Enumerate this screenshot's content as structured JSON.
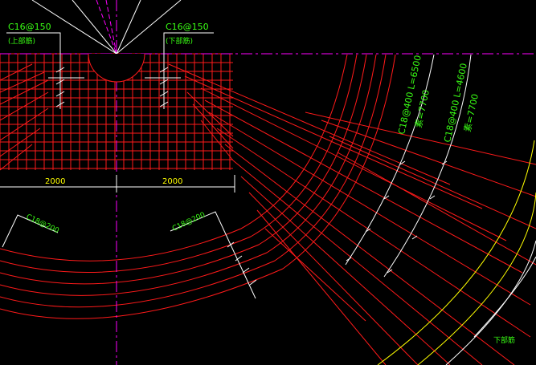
{
  "colors": {
    "background": "#000000",
    "rebar": "#ff1a1a",
    "axis": "#ff00ff",
    "leader": "#ffffff",
    "text": "#39ff14",
    "boundary": "#ffff00"
  },
  "labels": {
    "left_top_spec": "C16@150",
    "left_top_note": "(上部筋)",
    "right_top_spec": "C16@150",
    "right_top_note": "(下部筋)",
    "dim_left": "2000",
    "dim_right": "2000",
    "arc_left_spec": "C18@200",
    "arc_mid_spec": "C18@200",
    "radial_1_spec": "C18@400  L=6500",
    "radial_1_note": "素=7700",
    "radial_2_spec": "C18@400  L=4600",
    "radial_2_note": "素=7700",
    "corner_note": "下部筋"
  }
}
